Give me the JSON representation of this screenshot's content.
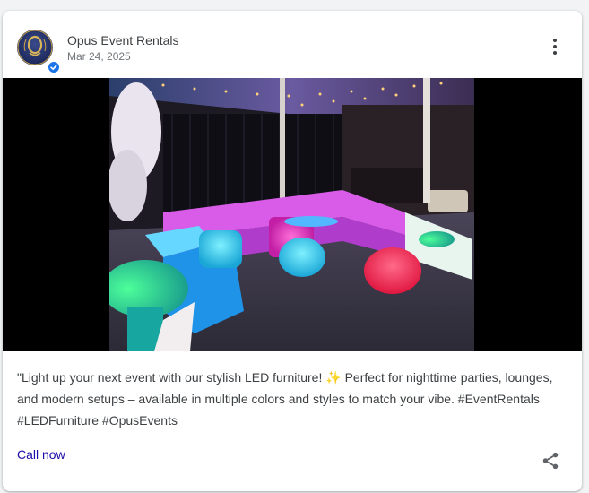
{
  "post": {
    "author": "Opus Event Rentals",
    "date": "Mar 24, 2025",
    "avatar_icon": "opus-logo",
    "verified_icon": "verified-check-icon",
    "body": "\"Light up your next event with our stylish LED furniture! ✨ Perfect for nighttime parties, lounges, and modern setups – available in multiple colors and styles to match your vibe. #EventRentals #LEDFurniture #OpusEvents",
    "cta_label": "Call now",
    "image_icon": "photo-led-furniture-lounge"
  },
  "colors": {
    "brand_navy": "#1e2a5e",
    "verified_blue": "#1a73e8",
    "cta_text": "#1a0dab",
    "body_text": "#3c4043"
  }
}
